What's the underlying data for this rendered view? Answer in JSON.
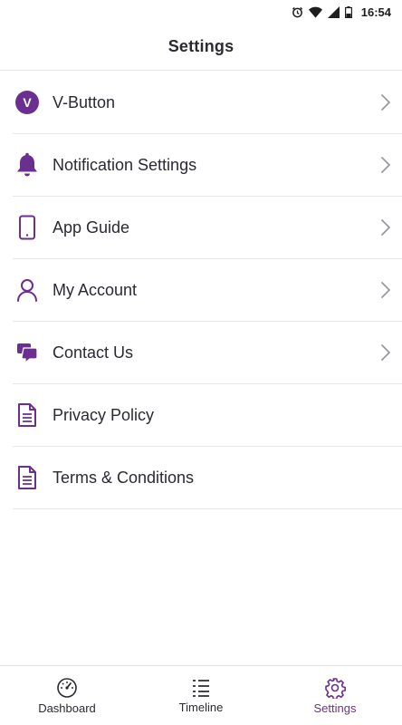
{
  "status_bar": {
    "time": "16:54"
  },
  "header": {
    "title": "Settings"
  },
  "menu": {
    "items": [
      {
        "label": "V-Button",
        "icon": "v-button-icon",
        "badge_letter": "V",
        "has_chevron": true
      },
      {
        "label": "Notification Settings",
        "icon": "bell-icon",
        "has_chevron": true
      },
      {
        "label": "App Guide",
        "icon": "phone-icon",
        "has_chevron": true
      },
      {
        "label": "My Account",
        "icon": "person-icon",
        "has_chevron": true
      },
      {
        "label": "Contact Us",
        "icon": "chat-icon",
        "has_chevron": true
      },
      {
        "label": "Privacy Policy",
        "icon": "document-icon",
        "has_chevron": false
      },
      {
        "label": "Terms & Conditions",
        "icon": "document-icon",
        "has_chevron": false
      }
    ]
  },
  "tabbar": {
    "tabs": [
      {
        "label": "Dashboard",
        "icon": "speedometer-icon",
        "active": false
      },
      {
        "label": "Timeline",
        "icon": "list-icon",
        "active": false
      },
      {
        "label": "Settings",
        "icon": "gear-icon",
        "active": true
      }
    ]
  },
  "colors": {
    "accent": "#6b2f8f",
    "text": "#2b2a33",
    "divider": "#e7e6eb",
    "chevron": "#9a99a3"
  }
}
